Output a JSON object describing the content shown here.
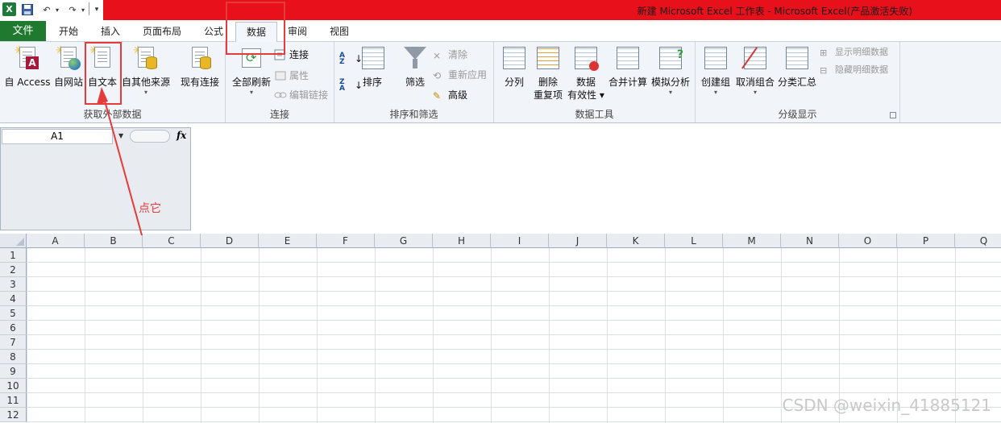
{
  "titlebar": {
    "title": "新建 Microsoft Excel 工作表  -  Microsoft Excel(产品激活失败)",
    "logo": "X",
    "icons": [
      "excel-logo-icon",
      "save-icon",
      "undo-icon",
      "redo-icon",
      "customize-icon"
    ]
  },
  "tabs": {
    "file": "文件",
    "home": "开始",
    "insert": "插入",
    "page_layout": "页面布局",
    "formulas": "公式",
    "data": "数据",
    "review": "审阅",
    "view": "视图"
  },
  "ribbon": {
    "external": {
      "label": "获取外部数据",
      "access": "自 Access",
      "web": "自网站",
      "text": "自文本",
      "other": "自其他来源",
      "existing": "现有连接"
    },
    "connections": {
      "label": "连接",
      "refresh_all": "全部刷新",
      "connections": "连接",
      "properties": "属性",
      "edit_links": "编辑链接"
    },
    "sort_filter": {
      "label": "排序和筛选",
      "sort": "排序",
      "filter": "筛选",
      "clear": "清除",
      "reapply": "重新应用",
      "advanced": "高级"
    },
    "data_tools": {
      "label": "数据工具",
      "text_to_columns": "分列",
      "remove_dup_1": "删除",
      "remove_dup_2": "重复项",
      "validation_1": "数据",
      "validation_2": "有效性",
      "consolidate": "合并计算",
      "what_if": "模拟分析"
    },
    "outline": {
      "label": "分级显示",
      "group": "创建组",
      "ungroup": "取消组合",
      "subtotal": "分类汇总",
      "show_detail": "显示明细数据",
      "hide_detail": "隐藏明细数据"
    }
  },
  "formula_bar": {
    "name_box": "A1",
    "fx": "fx",
    "formula": ""
  },
  "sheet": {
    "columns": [
      "A",
      "B",
      "C",
      "D",
      "E",
      "F",
      "G",
      "H",
      "I",
      "J",
      "K",
      "L",
      "M",
      "N",
      "O",
      "P",
      "Q"
    ],
    "rows": [
      "1",
      "2",
      "3",
      "4",
      "5",
      "6",
      "7",
      "8",
      "9",
      "10",
      "11",
      "12"
    ]
  },
  "annotation": {
    "label": "点它",
    "color": "#e53b3b"
  },
  "watermark": "CSDN @weixin_41885121",
  "colors": {
    "title_red": "#e8101a",
    "file_tab_green": "#1f7a2f",
    "ribbon_bg": "#f1f4f8"
  }
}
